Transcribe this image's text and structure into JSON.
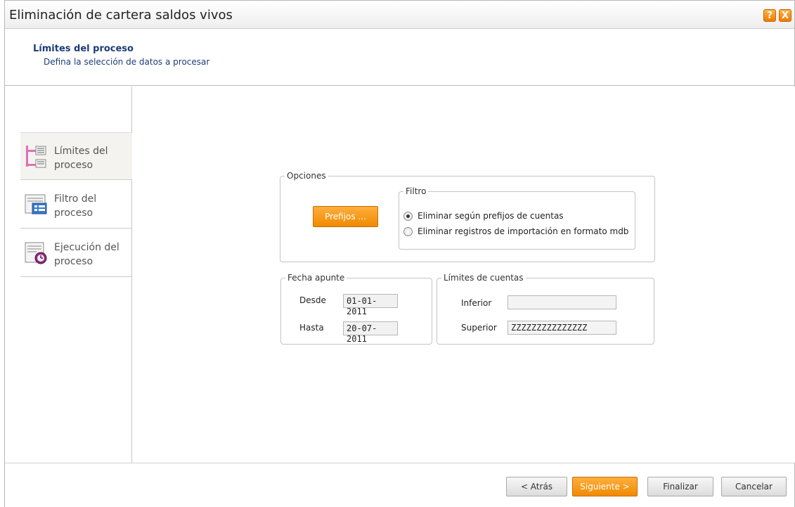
{
  "window": {
    "title": "Eliminación de cartera saldos vivos",
    "help_label": "?",
    "close_label": "X"
  },
  "header": {
    "title": "Límites del proceso",
    "subtitle": "Defina la selección de datos a procesar"
  },
  "sidebar": {
    "items": [
      {
        "label": "Límites del proceso",
        "active": true,
        "icon": "tree-structure-icon"
      },
      {
        "label": "Filtro del proceso",
        "active": false,
        "icon": "filter-list-icon"
      },
      {
        "label": "Ejecución del proceso",
        "active": false,
        "icon": "alarm-clock-icon"
      }
    ]
  },
  "opciones": {
    "legend": "Opciones",
    "prefijos_button": "Prefijos ...",
    "filtro": {
      "legend": "Filtro",
      "options": [
        {
          "label": "Eliminar según prefijos de cuentas",
          "checked": true
        },
        {
          "label": "Eliminar registros de importación en formato mdb",
          "checked": false
        }
      ]
    }
  },
  "fecha_apunte": {
    "legend": "Fecha apunte",
    "desde_label": "Desde",
    "desde_value": "01-01-2011",
    "hasta_label": "Hasta",
    "hasta_value": "20-07-2011"
  },
  "limites_cuentas": {
    "legend": "Límites de cuentas",
    "inferior_label": "Inferior",
    "inferior_value": "",
    "superior_label": "Superior",
    "superior_value": "ZZZZZZZZZZZZZZZ"
  },
  "footer": {
    "back": "< Atrás",
    "next": "Siguiente >",
    "finish": "Finalizar",
    "cancel": "Cancelar"
  },
  "colors": {
    "accent_orange": "#f08a00",
    "header_blue": "#1c3c78"
  }
}
